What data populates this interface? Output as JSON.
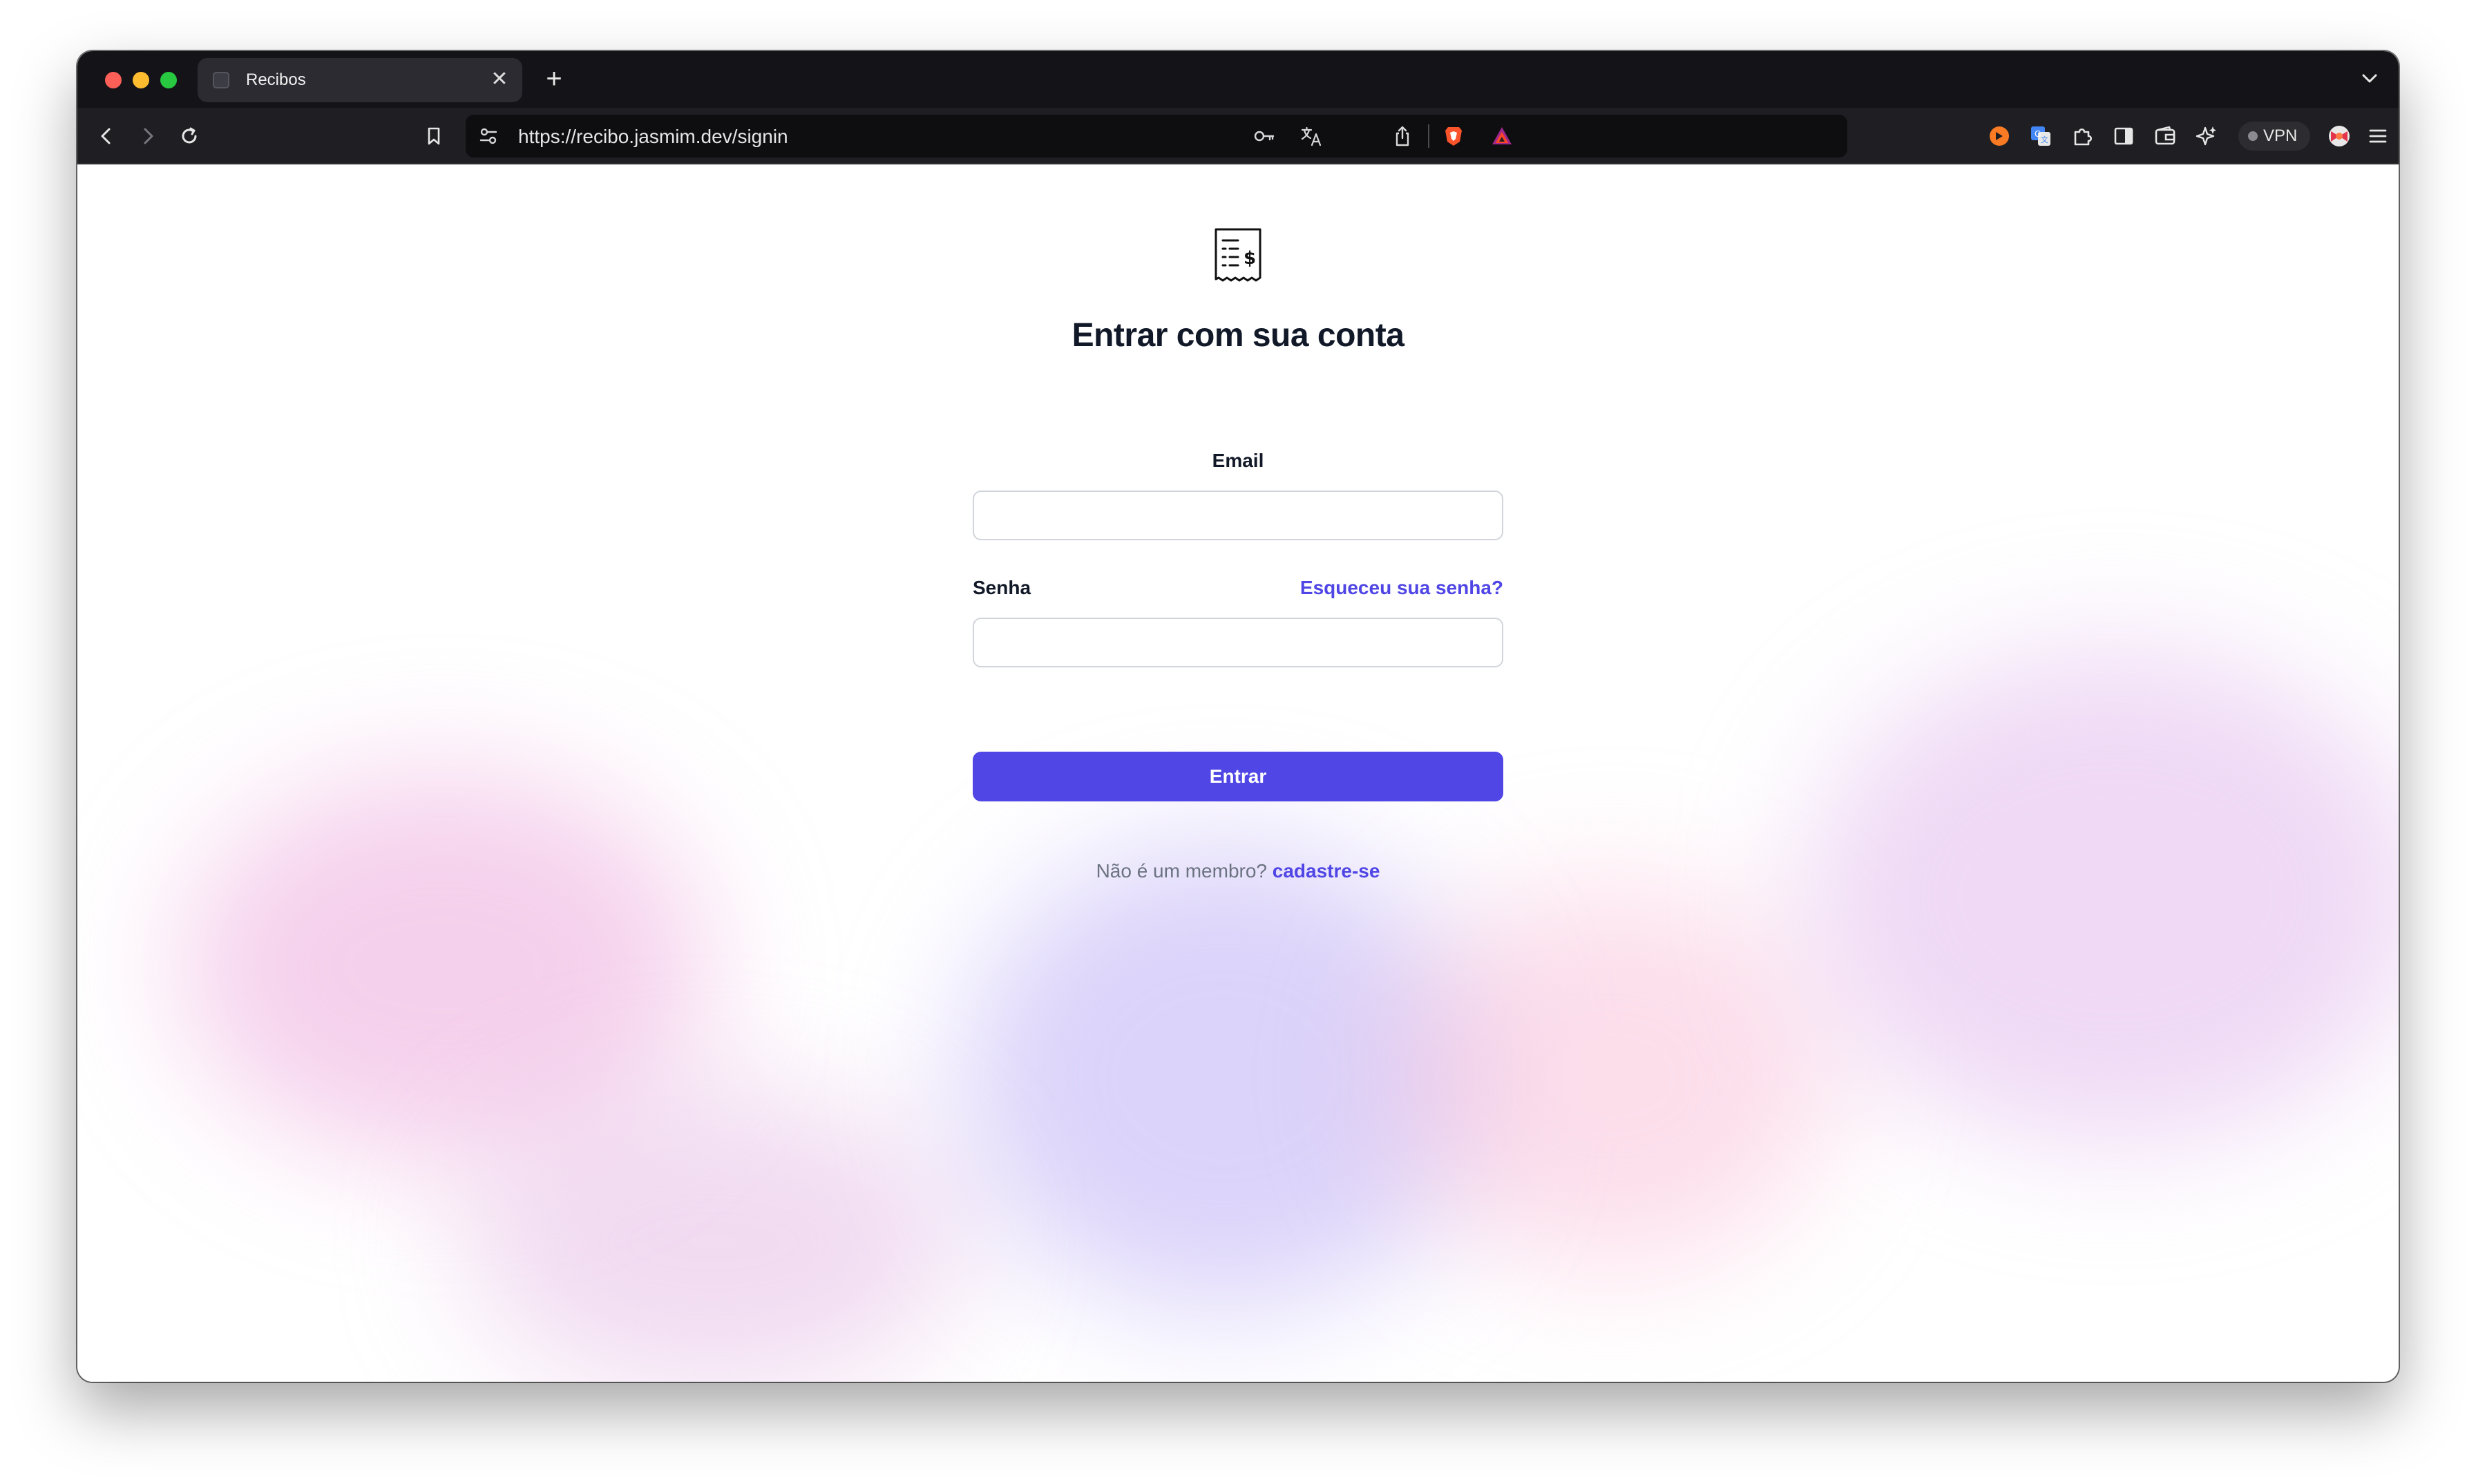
{
  "browser": {
    "tab": {
      "title": "Recibos",
      "close_label": "✕"
    },
    "new_tab_label": "+",
    "url": "https://recibo.jasmim.dev/signin",
    "vpn_label": "VPN"
  },
  "page": {
    "heading": "Entrar com sua conta",
    "email_label": "Email",
    "email_value": "",
    "password_label": "Senha",
    "password_value": "",
    "forgot_password": "Esqueceu sua senha?",
    "submit_label": "Entrar",
    "signup_prompt": "Não é um membro?",
    "signup_link": "cadastre-se"
  },
  "colors": {
    "accent": "#4f46e5",
    "heading": "#111827",
    "muted": "#6b7280",
    "chrome": "#1f1f23",
    "tabstrip": "#141418"
  }
}
